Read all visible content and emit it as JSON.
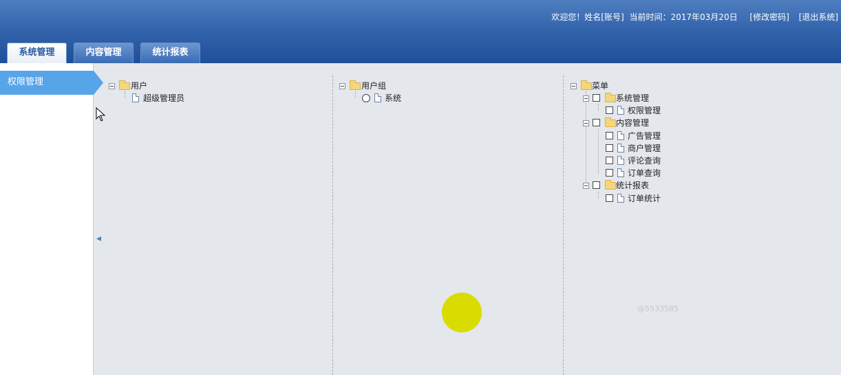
{
  "header": {
    "welcome": "欢迎您！姓名[账号]",
    "time_label": "当前时间：2017年03月20日",
    "change_password": "[修改密码]",
    "logout": "[退出系统]"
  },
  "tabs": [
    {
      "label": "系统管理",
      "active": true
    },
    {
      "label": "内容管理",
      "active": false
    },
    {
      "label": "统计报表",
      "active": false
    }
  ],
  "sidebar": {
    "items": [
      {
        "label": "权限管理",
        "active": true
      }
    ]
  },
  "user_tree": {
    "root": "用户",
    "children": [
      "超级管理员"
    ]
  },
  "group_tree": {
    "root": "用户组",
    "children": [
      "系统"
    ]
  },
  "menu_tree": {
    "root": "菜单",
    "groups": [
      {
        "label": "系统管理",
        "children": [
          "权限管理"
        ]
      },
      {
        "label": "内容管理",
        "children": [
          "广告管理",
          "商户管理",
          "评论查询",
          "订单查询"
        ]
      },
      {
        "label": "统计报表",
        "children": [
          "订单统计"
        ]
      }
    ]
  },
  "watermark": "@5533585",
  "colors": {
    "header_blue": "#2a5aa0",
    "sidebar_active": "#56a5e9",
    "content_bg": "#e4e7ec",
    "yellow_marker": "#d8dc00"
  }
}
